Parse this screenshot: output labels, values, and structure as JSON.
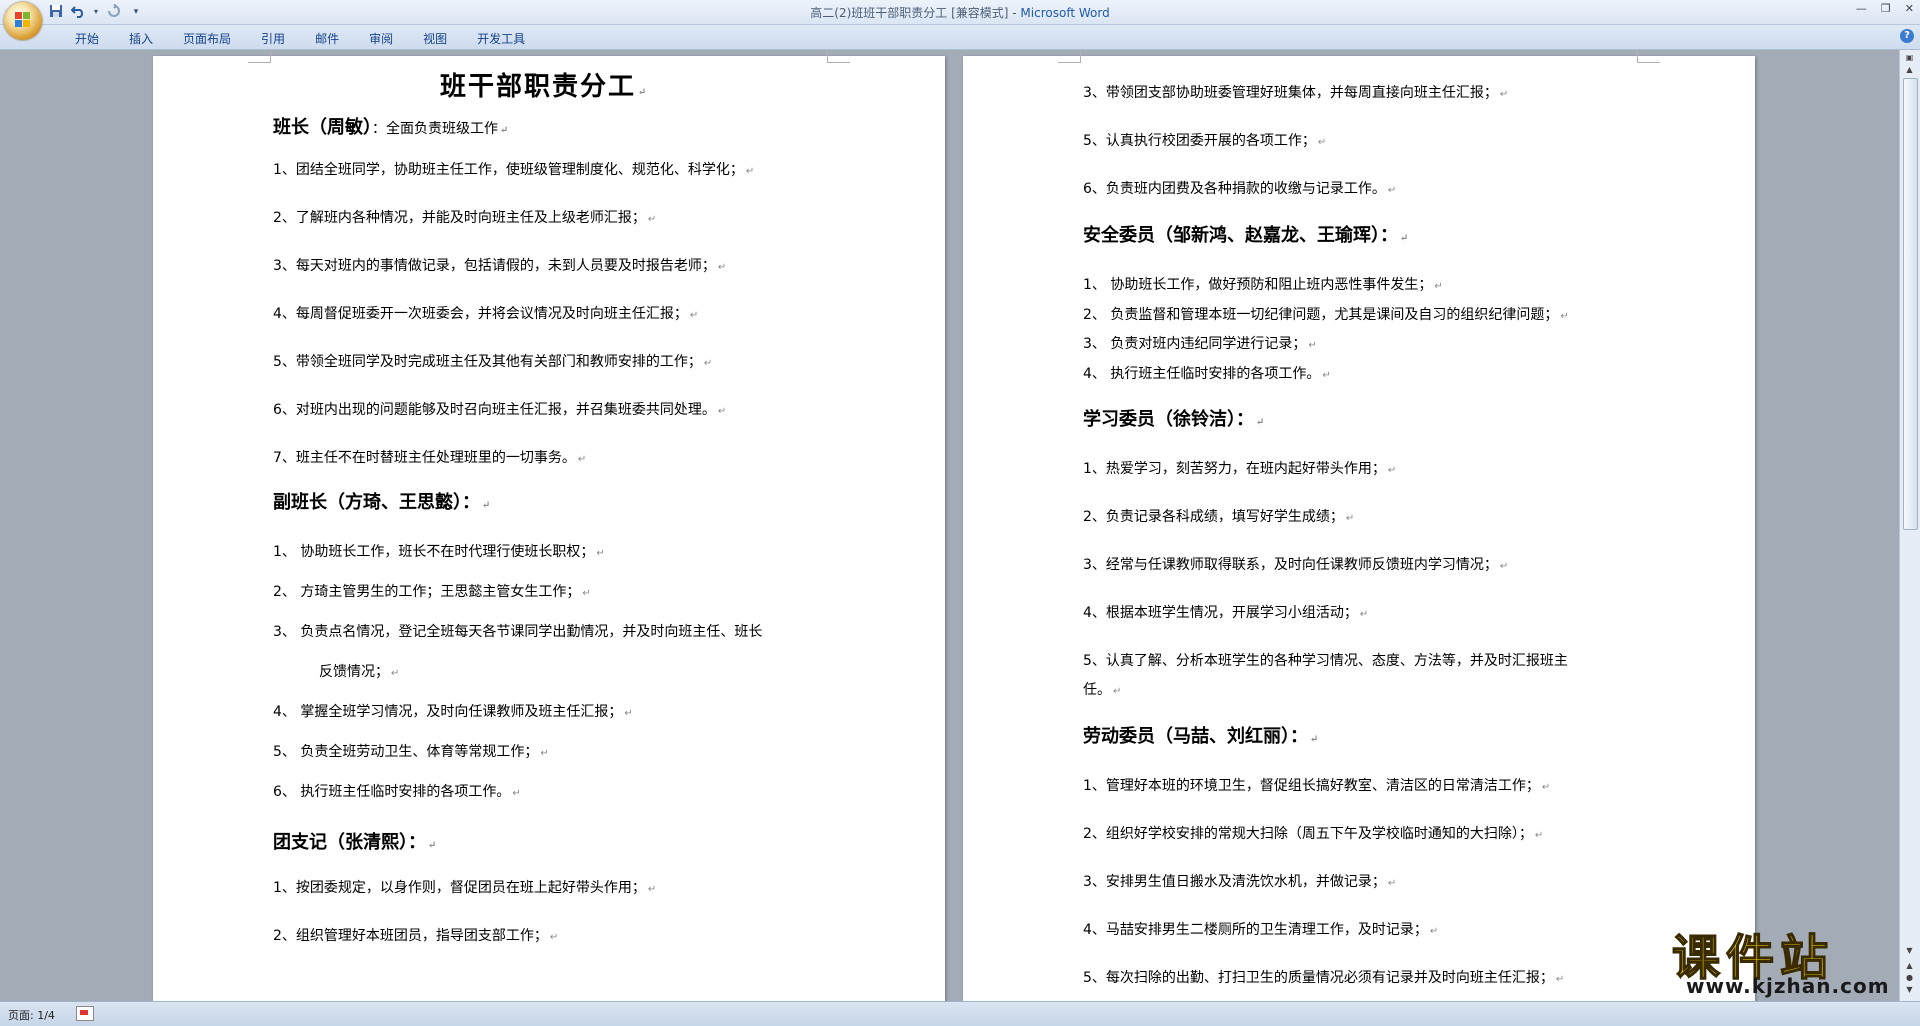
{
  "window": {
    "title": "高二(2)班班干部职责分工 [兼容模式] - ",
    "app_name": "Microsoft Word"
  },
  "qat": {
    "save_icon": "save-icon",
    "undo_icon": "undo-icon",
    "redo_icon": "redo-icon",
    "more": "▾"
  },
  "ribbon": {
    "tabs": [
      "开始",
      "插入",
      "页面布局",
      "引用",
      "邮件",
      "审阅",
      "视图",
      "开发工具"
    ]
  },
  "page1": {
    "title": "班干部职责分工",
    "monitor_heading": "班长（周敏）",
    "monitor_desc": "：全面负责班级工作",
    "monitor_items": [
      "1、团结全班同学，协助班主任工作，使班级管理制度化、规范化、科学化；",
      "2、了解班内各种情况，并能及时向班主任及上级老师汇报；",
      "3、每天对班内的事情做记录，包括请假的，未到人员要及时报告老师；",
      "4、每周督促班委开一次班委会，并将会议情况及时向班主任汇报；",
      "5、带领全班同学及时完成班主任及其他有关部门和教师安排的工作；",
      "6、对班内出现的问题能够及时召向班主任汇报，并召集班委共同处理。",
      "7、班主任不在时替班主任处理班里的一切事务。"
    ],
    "vice_heading": "副班长（方琦、王思懿）：",
    "vice_items": [
      "1、 协助班长工作，班长不在时代理行使班长职权；",
      "2、 方琦主管男生的工作；王思懿主管女生工作；",
      "3、 负责点名情况，登记全班每天各节课同学出勤情况，并及时向班主任、班长",
      "反馈情况；",
      "4、 掌握全班学习情况，及时向任课教师及班主任汇报；",
      "5、 负责全班劳动卫生、体育等常规工作；",
      "6、 执行班主任临时安排的各项工作。"
    ],
    "league_heading": "团支记（张清熙）：",
    "league_items": [
      "1、按团委规定，以身作则，督促团员在班上起好带头作用；",
      "2、组织管理好本班团员，指导团支部工作；"
    ]
  },
  "page2": {
    "league_items": [
      "3、带领团支部协助班委管理好班集体，并每周直接向班主任汇报；",
      "5、认真执行校团委开展的各项工作；",
      "6、负责班内团费及各种捐款的收缴与记录工作。"
    ],
    "safety_heading": "安全委员（邹新鸿、赵嘉龙、王瑜珲）：",
    "safety_items": [
      "1、 协助班长工作，做好预防和阻止班内恶性事件发生；",
      "2、 负责监督和管理本班一切纪律问题，尤其是课间及自习的组织纪律问题；",
      "3、 负责对班内违纪同学进行记录；",
      "4、 执行班主任临时安排的各项工作。"
    ],
    "study_heading": "学习委员（徐铃洁）：",
    "study_items": [
      "1、热爱学习，刻苦努力，在班内起好带头作用；",
      "2、负责记录各科成绩，填写好学生成绩；",
      "3、经常与任课教师取得联系，及时向任课教师反馈班内学习情况；",
      "4、根据本班学生情况，开展学习小组活动；",
      "5、认真了解、分析本班学生的各种学习情况、态度、方法等，并及时汇报班主",
      "任。"
    ],
    "labor_heading": "劳动委员（马喆、刘红丽）：",
    "labor_items": [
      "1、管理好本班的环境卫生，督促组长搞好教室、清洁区的日常清洁工作；",
      "2、组织好学校安排的常规大扫除（周五下午及学校临时通知的大扫除）；",
      "3、安排男生值日搬水及清洗饮水机，并做记录；",
      "4、马喆安排男生二楼厕所的卫生清理工作，及时记录；",
      "5、每次扫除的出勤、打扫卫生的质量情况必须有记录并及时向班主任汇报；"
    ]
  },
  "paragraph_mark": "↵",
  "status": {
    "page": "页面: 1/4"
  },
  "watermark": {
    "big": "课件站",
    "small": "www.kjzhan.com"
  }
}
